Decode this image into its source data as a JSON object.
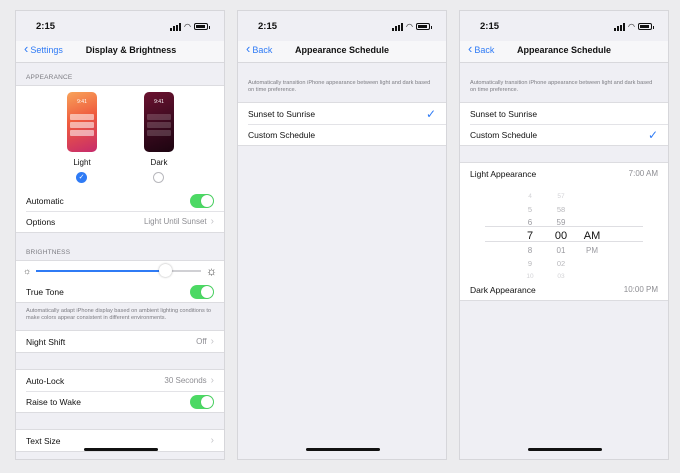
{
  "status_time": "2:15",
  "screen1": {
    "back_label": "Settings",
    "title": "Display & Brightness",
    "appearance_header": "APPEARANCE",
    "preview_time": "9:41",
    "light_label": "Light",
    "dark_label": "Dark",
    "automatic_label": "Automatic",
    "options_label": "Options",
    "options_value": "Light Until Sunset",
    "brightness_header": "BRIGHTNESS",
    "brightness_level": 0.78,
    "true_tone_label": "True Tone",
    "true_tone_note": "Automatically adapt iPhone display based on ambient lighting conditions to make colors appear consistent in different environments.",
    "night_shift_label": "Night Shift",
    "night_shift_value": "Off",
    "auto_lock_label": "Auto-Lock",
    "auto_lock_value": "30 Seconds",
    "raise_label": "Raise to Wake",
    "text_size_label": "Text Size"
  },
  "screen2": {
    "back_label": "Back",
    "title": "Appearance Schedule",
    "description": "Automatically transition iPhone appearance between light and dark based on time preference.",
    "option1": "Sunset to Sunrise",
    "option2": "Custom Schedule"
  },
  "screen3": {
    "back_label": "Back",
    "title": "Appearance Schedule",
    "description": "Automatically transition iPhone appearance between light and dark based on time preference.",
    "option1": "Sunset to Sunrise",
    "option2": "Custom Schedule",
    "light_label": "Light Appearance",
    "light_value": "7:00 AM",
    "picker_hours": [
      "4",
      "5",
      "6",
      "7",
      "8",
      "9",
      "10"
    ],
    "picker_minutes": [
      "57",
      "58",
      "59",
      "00",
      "01",
      "02",
      "03"
    ],
    "picker_period": [
      "AM",
      "PM"
    ],
    "dark_label": "Dark Appearance",
    "dark_value": "10:00 PM"
  },
  "colors": {
    "accent": "#2f7bf5",
    "toggle_on": "#4cd964"
  }
}
